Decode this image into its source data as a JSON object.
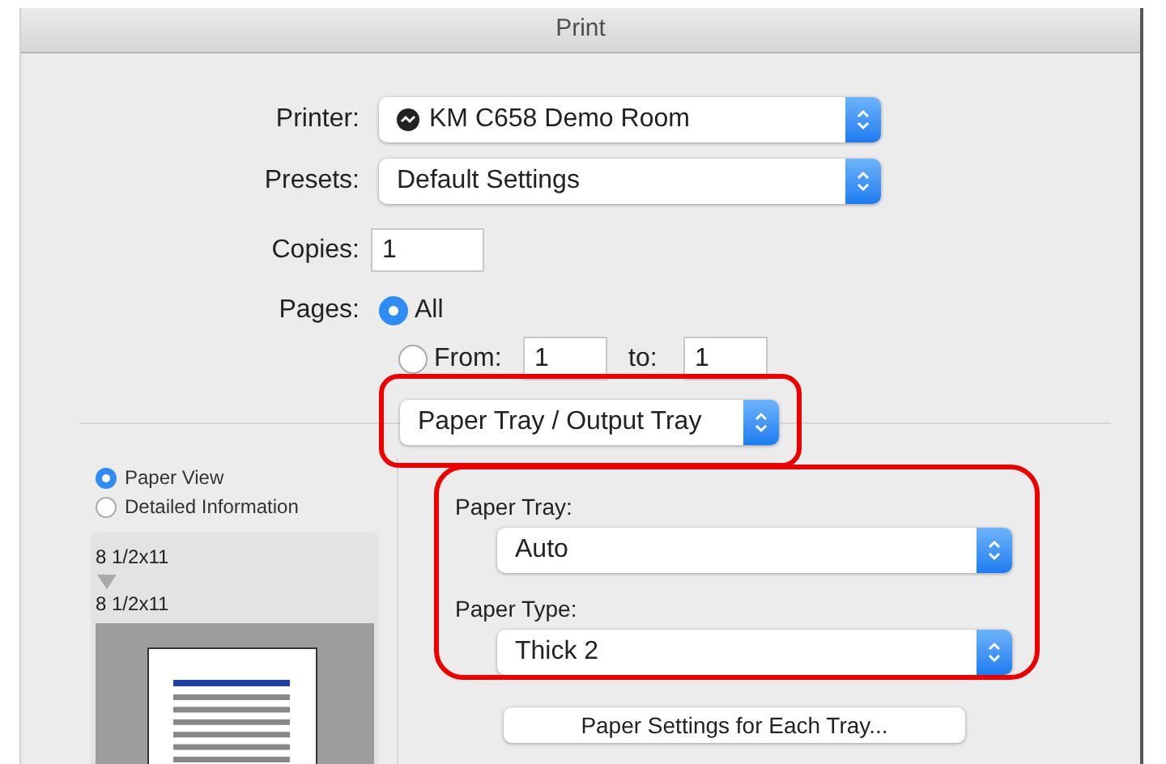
{
  "window": {
    "title": "Print"
  },
  "printer": {
    "label": "Printer:",
    "value": "KM C658 Demo Room"
  },
  "presets": {
    "label": "Presets:",
    "value": "Default Settings"
  },
  "copies": {
    "label": "Copies:",
    "value": "1"
  },
  "pages": {
    "label": "Pages:",
    "options": [
      {
        "kind": "all",
        "label": "All",
        "selected": true
      },
      {
        "kind": "range",
        "label": "From:",
        "selected": false,
        "from": "1",
        "to_label": "to:",
        "to": "1"
      }
    ]
  },
  "panel_menu": {
    "value": "Paper Tray / Output Tray",
    "highlighted": true
  },
  "preview": {
    "views": [
      {
        "label": "Paper View",
        "selected": true
      },
      {
        "label": "Detailed Information",
        "selected": false
      }
    ],
    "source_size": "8 1/2x11",
    "output_size": "8 1/2x11"
  },
  "tray_settings": {
    "highlighted": true,
    "fields": [
      {
        "label": "Paper Tray:",
        "value": "Auto"
      },
      {
        "label": "Paper Type:",
        "value": "Thick 2"
      }
    ]
  },
  "tray_button": "Paper Settings for Each Tray..."
}
